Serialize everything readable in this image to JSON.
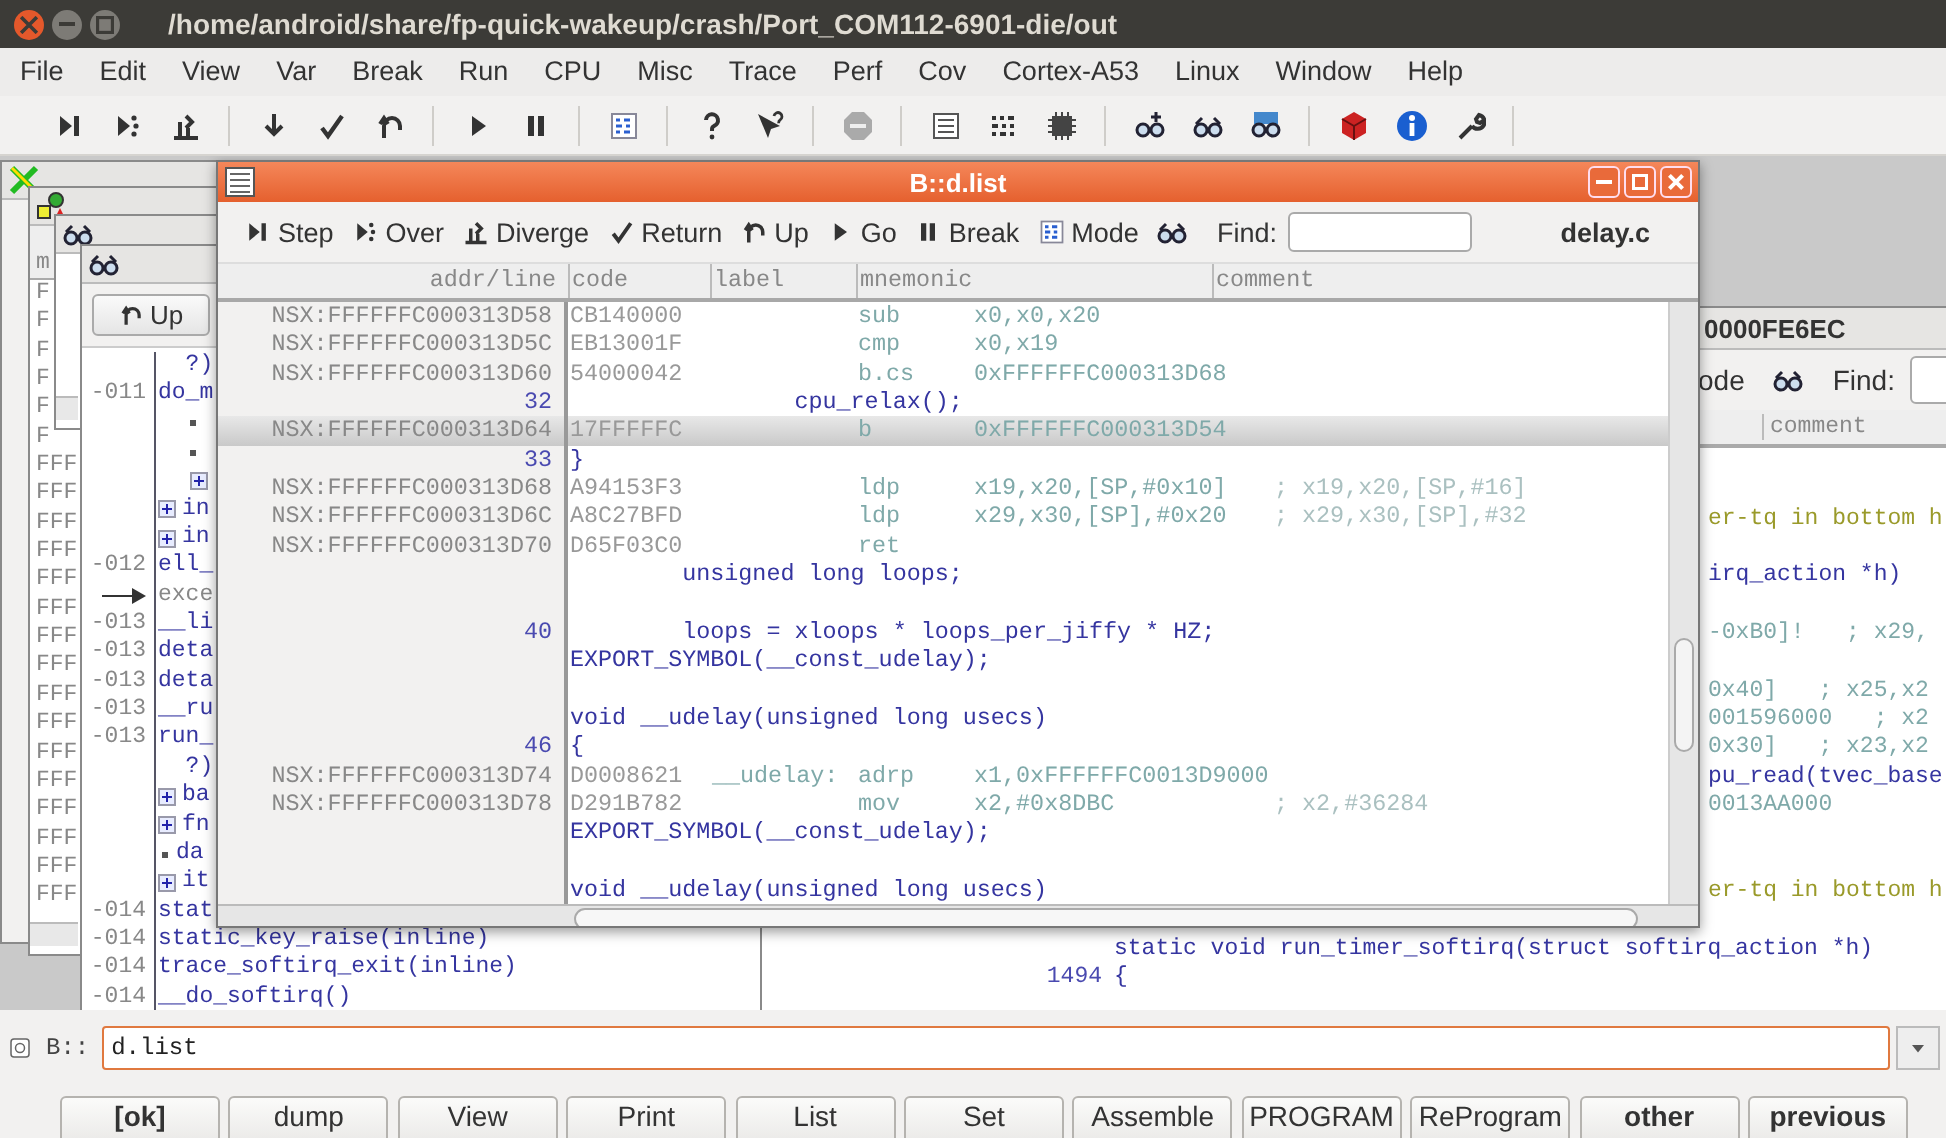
{
  "window": {
    "title": "/home/android/share/fp-quick-wakeup/crash/Port_COM112-6901-die/out"
  },
  "menu": [
    "File",
    "Edit",
    "View",
    "Var",
    "Break",
    "Run",
    "CPU",
    "Misc",
    "Trace",
    "Perf",
    "Cov",
    "Cortex-A53",
    "Linux",
    "Window",
    "Help"
  ],
  "list_window": {
    "title": "B::d.list",
    "find_label": "Find:",
    "file": "delay.c",
    "buttons": [
      {
        "label": "Step",
        "kind": "step"
      },
      {
        "label": "Over",
        "kind": "over"
      },
      {
        "label": "Diverge",
        "kind": "diverge"
      },
      {
        "label": "Return",
        "kind": "return"
      },
      {
        "label": "Up",
        "kind": "up"
      },
      {
        "label": "Go",
        "kind": "go"
      },
      {
        "label": "Break",
        "kind": "break"
      },
      {
        "label": "Mode",
        "kind": "mode"
      }
    ],
    "columns": [
      "addr/line",
      "code",
      "label",
      "mnemonic",
      "comment"
    ],
    "rows": [
      {
        "kind": "asm",
        "selected": false,
        "addr": "NSX:FFFFFFC000313D58",
        "code": "CB140000",
        "mnemonic": "sub",
        "operands": "x0,x0,x20"
      },
      {
        "kind": "asm",
        "selected": false,
        "addr": "NSX:FFFFFFC000313D5C",
        "code": "EB13001F",
        "mnemonic": "cmp",
        "operands": "x0,x19"
      },
      {
        "kind": "asm",
        "selected": false,
        "addr": "NSX:FFFFFFC000313D60",
        "code": "54000042",
        "mnemonic": "b.cs",
        "operands": "0xFFFFFFC000313D68"
      },
      {
        "kind": "src",
        "selected": false,
        "line": "32",
        "text": "                cpu_relax();"
      },
      {
        "kind": "asm",
        "selected": true,
        "addr": "NSX:FFFFFFC000313D64",
        "code": "17FFFFFC",
        "mnemonic": "b",
        "operands": "0xFFFFFFC000313D54"
      },
      {
        "kind": "src",
        "selected": false,
        "line": "33",
        "text": "}"
      },
      {
        "kind": "asm",
        "selected": false,
        "addr": "NSX:FFFFFFC000313D68",
        "code": "A94153F3",
        "mnemonic": "ldp",
        "operands": "x19,x20,[SP,#0x10]",
        "comment": "; x19,x20,[SP,#16]"
      },
      {
        "kind": "asm",
        "selected": false,
        "addr": "NSX:FFFFFFC000313D6C",
        "code": "A8C27BFD",
        "mnemonic": "ldp",
        "operands": "x29,x30,[SP],#0x20",
        "comment": "; x29,x30,[SP],#32"
      },
      {
        "kind": "asm",
        "selected": false,
        "addr": "NSX:FFFFFFC000313D70",
        "code": "D65F03C0",
        "mnemonic": "ret"
      },
      {
        "kind": "src",
        "selected": false,
        "text": "        unsigned long loops;"
      },
      {
        "kind": "blank",
        "selected": false
      },
      {
        "kind": "src",
        "selected": false,
        "line": "40",
        "text": "        loops = xloops * loops_per_jiffy * HZ;"
      },
      {
        "kind": "src",
        "selected": false,
        "text": "EXPORT_SYMBOL(__const_udelay);"
      },
      {
        "kind": "blank",
        "selected": false
      },
      {
        "kind": "src",
        "selected": false,
        "text": "void __udelay(unsigned long usecs)"
      },
      {
        "kind": "src",
        "selected": false,
        "line": "46",
        "text": "{"
      },
      {
        "kind": "asm",
        "selected": false,
        "addr": "NSX:FFFFFFC000313D74",
        "code": "D0008621",
        "label": "__udelay:",
        "mnemonic": "adrp",
        "operands": "x1,0xFFFFFFC0013D9000"
      },
      {
        "kind": "asm",
        "selected": false,
        "addr": "NSX:FFFFFFC000313D78",
        "code": "D291B782",
        "mnemonic": "mov",
        "operands": "x2,#0x8DBC",
        "comment": "; x2,#36284"
      },
      {
        "kind": "src",
        "selected": false,
        "text": "EXPORT_SYMBOL(__const_udelay);"
      },
      {
        "kind": "blank",
        "selected": false
      },
      {
        "kind": "src",
        "selected": false,
        "text": "void __udelay(unsigned long usecs)"
      }
    ]
  },
  "stack_window": {
    "header": "m",
    "rows": [
      "F",
      "F",
      "F",
      "F",
      "F",
      "F",
      "FFF",
      "FFF",
      "FFF",
      "FFF",
      "FFF",
      "FFF",
      "FFF",
      "FFF",
      "FFF",
      "FFF",
      "FFF",
      "FFF",
      "FFF",
      "FFF",
      "FFF",
      "FFF"
    ]
  },
  "frame_window": {
    "up_button": "Up",
    "rows": [
      {
        "kind": "text",
        "text": "  ?)"
      },
      {
        "kind": "text",
        "num": "-011",
        "text": "do_m"
      },
      {
        "kind": "bullet"
      },
      {
        "kind": "bullet"
      },
      {
        "kind": "plus"
      },
      {
        "kind": "plus",
        "text": "in"
      },
      {
        "kind": "plus",
        "text": "in"
      },
      {
        "kind": "text",
        "num": "-012",
        "text": "ell_"
      },
      {
        "kind": "arrow",
        "text": "exce"
      },
      {
        "kind": "text",
        "num": "-013",
        "text": "__li"
      },
      {
        "kind": "text",
        "num": "-013",
        "text": "deta"
      },
      {
        "kind": "text",
        "num": "-013",
        "text": "deta"
      },
      {
        "kind": "text",
        "num": "-013",
        "text": "__ru"
      },
      {
        "kind": "text",
        "num": "-013",
        "text": "run_"
      },
      {
        "kind": "text",
        "text": "  ?)"
      },
      {
        "kind": "plus",
        "text": "ba"
      },
      {
        "kind": "plus",
        "text": "fn"
      },
      {
        "kind": "bullet",
        "text": "da"
      },
      {
        "kind": "plus",
        "text": "it"
      },
      {
        "kind": "text",
        "num": "-014",
        "text": "stat"
      },
      {
        "kind": "text",
        "num": "-014",
        "text": "static_key_raise(inline)"
      },
      {
        "kind": "text",
        "num": "-014",
        "text": "trace_softirq_exit(inline)"
      },
      {
        "kind": "text",
        "num": "-014",
        "text": "__do_softirq()"
      }
    ]
  },
  "right_window": {
    "title": "0000FE6EC",
    "mode_label": "ode",
    "find_label": "Find:",
    "column": "comment",
    "upper_rows": [
      {
        "kind": "blank"
      },
      {
        "kind": "blank"
      },
      {
        "kind": "comment",
        "text": "er-tq in bottom h"
      },
      {
        "kind": "blank"
      },
      {
        "kind": "source",
        "text": "irq_action *h)"
      },
      {
        "kind": "blank"
      },
      {
        "kind": "asm",
        "text": "-0xB0]!   ; x29,"
      },
      {
        "kind": "blank"
      },
      {
        "kind": "asm",
        "text": "0x40]   ; x25,x2"
      },
      {
        "kind": "asm",
        "text": "001596000   ; x2"
      },
      {
        "kind": "asm",
        "text": "0x30]   ; x23,x2"
      },
      {
        "kind": "source",
        "text": "pu_read(tvec_base"
      },
      {
        "kind": "asm",
        "text": "0013AA000"
      },
      {
        "kind": "blank"
      },
      {
        "kind": "blank"
      },
      {
        "kind": "comment",
        "text": "er-tq in bottom h"
      },
      {
        "kind": "blank"
      }
    ],
    "lower_rows": [
      {
        "text": "static void run_timer_softirq(struct softirq_action *h)"
      },
      {
        "line": "1494",
        "text": "{"
      }
    ]
  },
  "command": {
    "prompt": "B::",
    "value": "d.list"
  },
  "buttons": [
    {
      "label": "[ok]",
      "bold": true
    },
    {
      "label": "dump",
      "bold": false
    },
    {
      "label": "View",
      "bold": false
    },
    {
      "label": "Print",
      "bold": false
    },
    {
      "label": "List",
      "bold": false
    },
    {
      "label": "Set",
      "bold": false
    },
    {
      "label": "Assemble",
      "bold": false
    },
    {
      "label": "PROGRAM",
      "bold": false
    },
    {
      "label": "ReProgram",
      "bold": false
    },
    {
      "label": "other",
      "bold": true
    },
    {
      "label": "previous",
      "bold": true
    }
  ]
}
